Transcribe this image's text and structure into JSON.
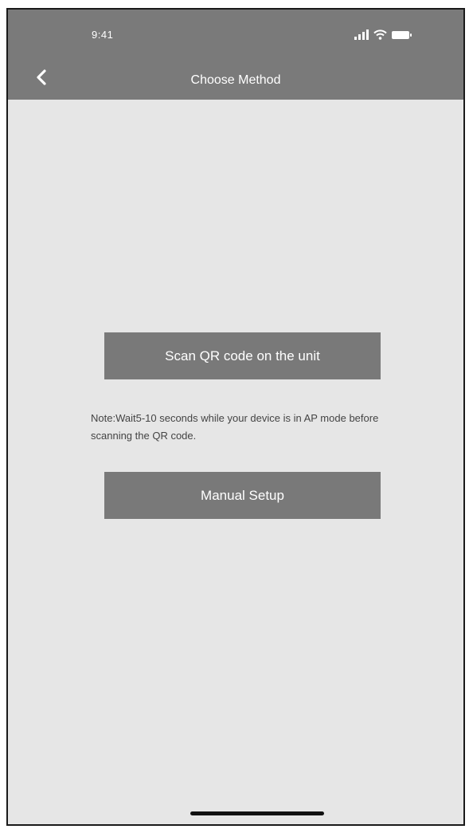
{
  "status_bar": {
    "time": "9:41",
    "icons": [
      "signal-icon",
      "wifi-icon",
      "battery-icon"
    ]
  },
  "nav": {
    "back_icon": "back-chevron-icon",
    "title": "Choose Method"
  },
  "main": {
    "scan_button_label": "Scan QR code on the unit",
    "note": "Note:Wait5-10 seconds while your device is in AP mode before scanning the QR code.",
    "manual_button_label": "Manual Setup"
  },
  "colors": {
    "header_bg": "#7a7a7a",
    "screen_bg": "#e6e6e6",
    "button_bg": "#797979",
    "text_light": "#ffffff",
    "note_text": "#444444"
  }
}
